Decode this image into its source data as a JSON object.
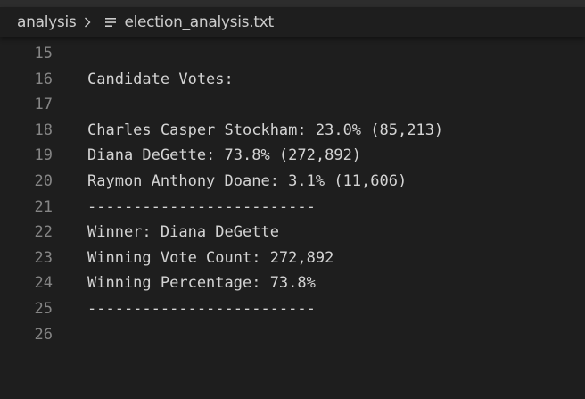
{
  "breadcrumb": {
    "folder": "analysis",
    "file": "election_analysis.txt"
  },
  "editor": {
    "lines": [
      {
        "number": "15",
        "text": ""
      },
      {
        "number": "16",
        "text": "Candidate Votes:"
      },
      {
        "number": "17",
        "text": ""
      },
      {
        "number": "18",
        "text": "Charles Casper Stockham: 23.0% (85,213)"
      },
      {
        "number": "19",
        "text": "Diana DeGette: 73.8% (272,892)"
      },
      {
        "number": "20",
        "text": "Raymon Anthony Doane: 3.1% (11,606)"
      },
      {
        "number": "21",
        "text": "-------------------------"
      },
      {
        "number": "22",
        "text": "Winner: Diana DeGette"
      },
      {
        "number": "23",
        "text": "Winning Vote Count: 272,892"
      },
      {
        "number": "24",
        "text": "Winning Percentage: 73.8%"
      },
      {
        "number": "25",
        "text": "-------------------------"
      },
      {
        "number": "26",
        "text": ""
      }
    ]
  },
  "colors": {
    "background": "#1e1e1e",
    "text": "#d4d4d4",
    "line_number": "#858585",
    "breadcrumb_text": "#cccccc"
  },
  "icons": {
    "separator": "chevron-right-icon",
    "file": "text-file-icon"
  }
}
